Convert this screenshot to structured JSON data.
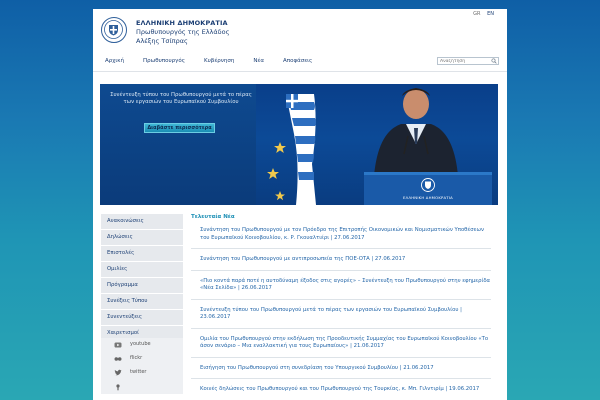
{
  "header": {
    "line1": "ΕΛΛΗΝΙΚΗ ΔΗΜΟΚΡΑΤΙΑ",
    "line2": "Πρωθυπουργός της Ελλάδος",
    "line3": "Αλέξης Τσίπρας",
    "lang_gr": "GR",
    "lang_en": "EN"
  },
  "nav": {
    "items": [
      "Αρχική",
      "Πρωθυπουργός",
      "Κυβέρνηση",
      "Νέα",
      "Αποφάσεις"
    ],
    "search_placeholder": "Αναζήτηση"
  },
  "hero": {
    "caption": "Συνέντευξη τύπου του Πρωθυπουργού μετά το πέρας των εργασιών του Ευρωπαϊκού Συμβουλίου",
    "button_label": "Διαβάστε περισσότερα",
    "podium_text": "ΕΛΛΗΝΙΚΗ ΔΗΜΟΚΡΑΤΙΑ"
  },
  "sidebar": {
    "items": [
      "Ανακοινώσεις",
      "Δηλώσεις",
      "Επιστολές",
      "Ομιλίες",
      "Πρόγραμμα",
      "Συνέξεις Τύπου",
      "Συνεντεύξεις",
      "Χαιρετισμοί"
    ]
  },
  "social": {
    "items": [
      {
        "label": "youtube",
        "icon": "youtube-icon"
      },
      {
        "label": "flickr",
        "icon": "flickr-icon"
      },
      {
        "label": "twitter",
        "icon": "twitter-icon"
      },
      {
        "label": "",
        "icon": "podcast-icon"
      }
    ]
  },
  "news": {
    "title": "Τελευταία Νέα",
    "items": [
      "Συνάντηση του Πρωθυπουργού με τον Πρόεδρο της Επιτροπής Οικονομικών και Νομισματικών Υποθέσεων του Ευρωπαϊκού Κοινοβουλίου, κ. Ρ. Γκουαλτιέρι | 27.06.2017",
      "Συνάντηση του Πρωθυπουργού με αντιπροσωπεία της ΠΟΕ-ΟΤΑ | 27.06.2017",
      "«Πιο κοντά παρά ποτέ η αυτοδύναμη έξοδος στις αγορές» – Συνέντευξη του Πρωθυπουργού στην εφημερίδα «Νέα Σελίδα» | 26.06.2017",
      "Συνέντευξη τύπου του Πρωθυπουργού μετά το πέρας των εργασιών του Ευρωπαϊκού Συμβουλίου | 23.06.2017",
      "Ομιλία του Πρωθυπουργού στην εκδήλωση της Προοδευτικής Συμμαχίας του Ευρωπαϊκού Κοινοβουλίου «Το άσον σενάριο – Μια εναλλακτική για τους Ευρωπαίους» | 21.06.2017",
      "Εισήγηση του Πρωθυπουργού στη συνεδρίαση του Υπουργικού Συμβουλίου | 21.06.2017",
      "Κοινές δηλώσεις του Πρωθυπουργού και του Πρωθυπουργού της Τουρκίας, κ. Μπ. Γιλντιρίμ | 19.06.2017"
    ]
  },
  "colors": {
    "brand_blue": "#1c3f74",
    "accent_teal": "#1c8fb5",
    "link_blue": "#2466a8"
  }
}
